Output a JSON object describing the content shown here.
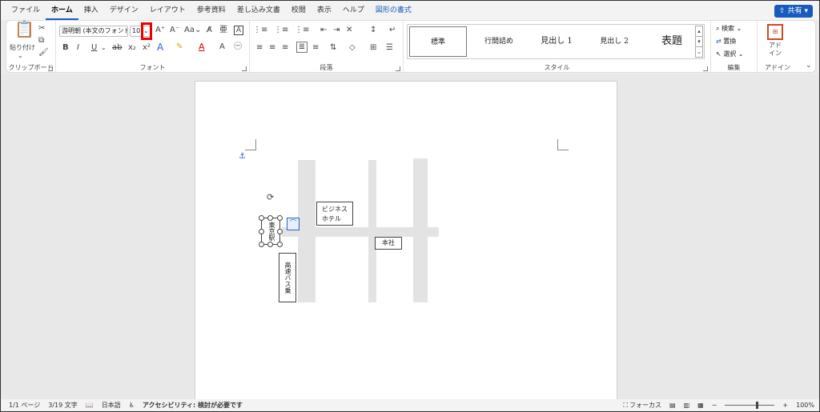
{
  "menu": {
    "tabs": [
      "ファイル",
      "ホーム",
      "挿入",
      "デザイン",
      "レイアウト",
      "参考資料",
      "差し込み文書",
      "校閲",
      "表示",
      "ヘルプ",
      "図形の書式"
    ],
    "share": "共有"
  },
  "ribbon": {
    "clipboard": {
      "paste": "貼り付け",
      "label": "クリップボード"
    },
    "font": {
      "name": "游明朝 (本文のフォント",
      "size": "10",
      "label": "フォント"
    },
    "paragraph": {
      "label": "段落"
    },
    "styles": {
      "items": [
        "標準",
        "行間詰め",
        "見出し 1",
        "見出し 2",
        "表題"
      ],
      "label": "スタイル"
    },
    "editing": {
      "search": "検索",
      "replace": "置換",
      "select": "選択",
      "label": "編集"
    },
    "addin": {
      "button": "アド\nイン",
      "label": "アドイン"
    }
  },
  "document": {
    "labels": {
      "business_hotel_line1": "ビジネス",
      "business_hotel_line2": "ホテル",
      "head_office": "本社",
      "tokyo_station": "東京駅",
      "vertical_box": "高速バス乗"
    }
  },
  "status": {
    "page": "1/1 ページ",
    "words": "3/19 文字",
    "language": "日本語",
    "accessibility": "アクセシビリティ: 検討が必要です",
    "focus": "フォーカス",
    "zoom": "100%"
  }
}
